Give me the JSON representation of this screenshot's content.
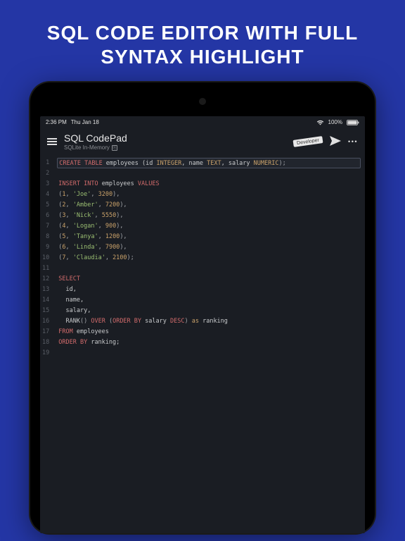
{
  "promo": {
    "line1": "SQL CODE EDITOR WITH FULL",
    "line2": "SYNTAX HIGHLIGHT"
  },
  "statusBar": {
    "time": "2:36 PM",
    "date": "Thu Jan 18",
    "battery": "100%"
  },
  "header": {
    "title": "SQL CodePad",
    "subtitle": "SQLite In-Memory",
    "badge": "Developer"
  },
  "code": {
    "lines": [
      {
        "n": 1,
        "hl": true,
        "tokens": [
          {
            "t": "CREATE",
            "c": "kw"
          },
          {
            "t": " ",
            "c": ""
          },
          {
            "t": "TABLE",
            "c": "kw"
          },
          {
            "t": " employees (id ",
            "c": "ident"
          },
          {
            "t": "INTEGER",
            "c": "type"
          },
          {
            "t": ", name ",
            "c": "ident"
          },
          {
            "t": "TEXT",
            "c": "type"
          },
          {
            "t": ", salary ",
            "c": "ident"
          },
          {
            "t": "NUMERIC",
            "c": "type"
          },
          {
            "t": ");",
            "c": "punct"
          }
        ]
      },
      {
        "n": 2,
        "tokens": []
      },
      {
        "n": 3,
        "tokens": [
          {
            "t": "INSERT",
            "c": "kw"
          },
          {
            "t": " ",
            "c": ""
          },
          {
            "t": "INTO",
            "c": "kw"
          },
          {
            "t": " employees ",
            "c": "ident"
          },
          {
            "t": "VALUES",
            "c": "kw"
          }
        ]
      },
      {
        "n": 4,
        "tokens": [
          {
            "t": "(",
            "c": "punct"
          },
          {
            "t": "1",
            "c": "num"
          },
          {
            "t": ", ",
            "c": "punct"
          },
          {
            "t": "'Joe'",
            "c": "str"
          },
          {
            "t": ", ",
            "c": "punct"
          },
          {
            "t": "3200",
            "c": "num"
          },
          {
            "t": "),",
            "c": "punct"
          }
        ]
      },
      {
        "n": 5,
        "tokens": [
          {
            "t": "(",
            "c": "punct"
          },
          {
            "t": "2",
            "c": "num"
          },
          {
            "t": ", ",
            "c": "punct"
          },
          {
            "t": "'Amber'",
            "c": "str"
          },
          {
            "t": ", ",
            "c": "punct"
          },
          {
            "t": "7200",
            "c": "num"
          },
          {
            "t": "),",
            "c": "punct"
          }
        ]
      },
      {
        "n": 6,
        "tokens": [
          {
            "t": "(",
            "c": "punct"
          },
          {
            "t": "3",
            "c": "num"
          },
          {
            "t": ", ",
            "c": "punct"
          },
          {
            "t": "'Nick'",
            "c": "str"
          },
          {
            "t": ", ",
            "c": "punct"
          },
          {
            "t": "5550",
            "c": "num"
          },
          {
            "t": "),",
            "c": "punct"
          }
        ]
      },
      {
        "n": 7,
        "tokens": [
          {
            "t": "(",
            "c": "punct"
          },
          {
            "t": "4",
            "c": "num"
          },
          {
            "t": ", ",
            "c": "punct"
          },
          {
            "t": "'Logan'",
            "c": "str"
          },
          {
            "t": ", ",
            "c": "punct"
          },
          {
            "t": "900",
            "c": "num"
          },
          {
            "t": "),",
            "c": "punct"
          }
        ]
      },
      {
        "n": 8,
        "tokens": [
          {
            "t": "(",
            "c": "punct"
          },
          {
            "t": "5",
            "c": "num"
          },
          {
            "t": ", ",
            "c": "punct"
          },
          {
            "t": "'Tanya'",
            "c": "str"
          },
          {
            "t": ", ",
            "c": "punct"
          },
          {
            "t": "1200",
            "c": "num"
          },
          {
            "t": "),",
            "c": "punct"
          }
        ]
      },
      {
        "n": 9,
        "tokens": [
          {
            "t": "(",
            "c": "punct"
          },
          {
            "t": "6",
            "c": "num"
          },
          {
            "t": ", ",
            "c": "punct"
          },
          {
            "t": "'Linda'",
            "c": "str"
          },
          {
            "t": ", ",
            "c": "punct"
          },
          {
            "t": "7900",
            "c": "num"
          },
          {
            "t": "),",
            "c": "punct"
          }
        ]
      },
      {
        "n": 10,
        "tokens": [
          {
            "t": "(",
            "c": "punct"
          },
          {
            "t": "7",
            "c": "num"
          },
          {
            "t": ", ",
            "c": "punct"
          },
          {
            "t": "'Claudia'",
            "c": "str"
          },
          {
            "t": ", ",
            "c": "punct"
          },
          {
            "t": "2100",
            "c": "num"
          },
          {
            "t": ");",
            "c": "punct"
          }
        ]
      },
      {
        "n": 11,
        "tokens": []
      },
      {
        "n": 12,
        "tokens": [
          {
            "t": "SELECT",
            "c": "kw"
          }
        ]
      },
      {
        "n": 13,
        "tokens": [
          {
            "t": "  id,",
            "c": "ident"
          }
        ]
      },
      {
        "n": 14,
        "tokens": [
          {
            "t": "  name,",
            "c": "ident"
          }
        ]
      },
      {
        "n": 15,
        "tokens": [
          {
            "t": "  salary,",
            "c": "ident"
          }
        ]
      },
      {
        "n": 16,
        "tokens": [
          {
            "t": "  ",
            "c": ""
          },
          {
            "t": "RANK",
            "c": "fn"
          },
          {
            "t": "() ",
            "c": "punct"
          },
          {
            "t": "OVER",
            "c": "kw"
          },
          {
            "t": " (",
            "c": "punct"
          },
          {
            "t": "ORDER BY",
            "c": "kw"
          },
          {
            "t": " salary ",
            "c": "ident"
          },
          {
            "t": "DESC",
            "c": "kw"
          },
          {
            "t": ") ",
            "c": "punct"
          },
          {
            "t": "as",
            "c": "alias"
          },
          {
            "t": " ranking",
            "c": "ident"
          }
        ]
      },
      {
        "n": 17,
        "tokens": [
          {
            "t": "FROM",
            "c": "kw"
          },
          {
            "t": " employees",
            "c": "ident"
          }
        ]
      },
      {
        "n": 18,
        "tokens": [
          {
            "t": "ORDER BY",
            "c": "kw"
          },
          {
            "t": " ranking;",
            "c": "ident"
          }
        ]
      },
      {
        "n": 19,
        "tokens": []
      }
    ]
  }
}
